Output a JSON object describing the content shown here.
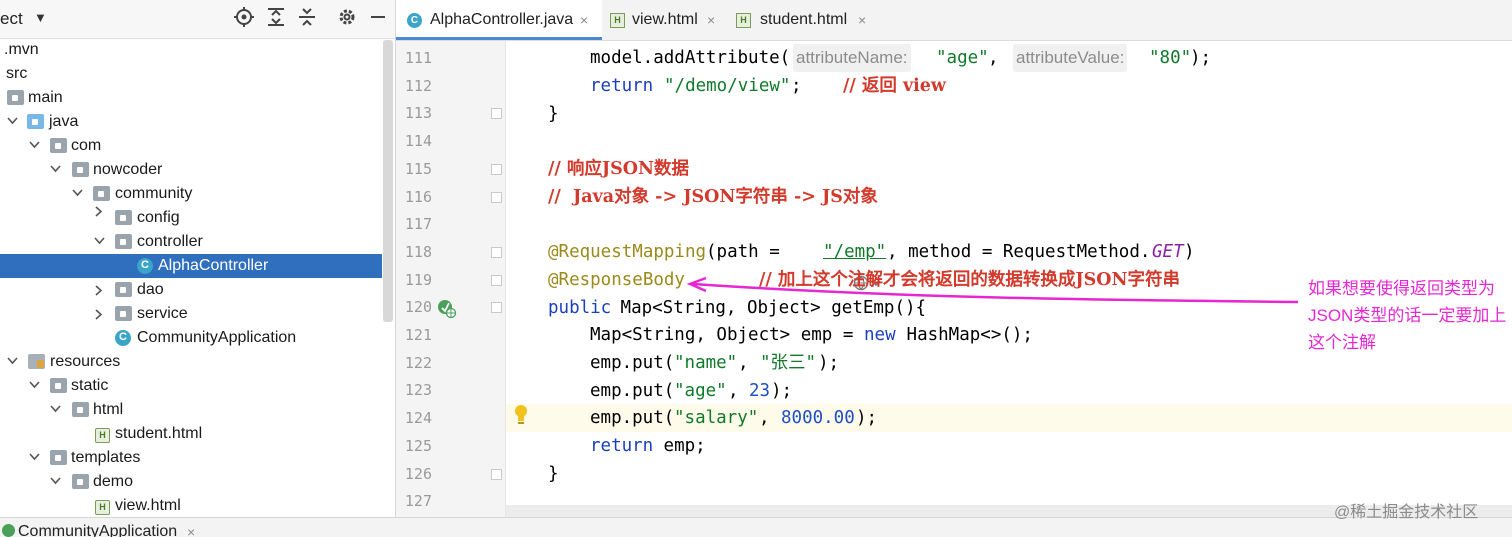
{
  "project_panel": {
    "title": "ect",
    "header_icons": [
      "target-icon",
      "expand-all-icon",
      "collapse-all-icon",
      "gear-icon",
      "minimize-icon"
    ],
    "tree": [
      {
        "label": ".mvn",
        "icon": "folder-icon",
        "arrow": "none"
      },
      {
        "label": "src",
        "icon": "none",
        "arrow": "none"
      },
      {
        "label": "main",
        "icon": "folder-icon",
        "arrow": "none"
      },
      {
        "label": "java",
        "icon": "source-folder-icon",
        "arrow": "expanded"
      },
      {
        "label": "com",
        "icon": "package-icon",
        "arrow": "expanded"
      },
      {
        "label": "nowcoder",
        "icon": "package-icon",
        "arrow": "expanded"
      },
      {
        "label": "community",
        "icon": "package-icon",
        "arrow": "expanded"
      },
      {
        "label": "config",
        "icon": "package-icon",
        "arrow": "collapsed"
      },
      {
        "label": "controller",
        "icon": "package-icon",
        "arrow": "expanded"
      },
      {
        "label": "AlphaController",
        "icon": "java-class-icon",
        "arrow": "none",
        "selected": true
      },
      {
        "label": "dao",
        "icon": "package-icon",
        "arrow": "collapsed"
      },
      {
        "label": "service",
        "icon": "package-icon",
        "arrow": "collapsed"
      },
      {
        "label": "CommunityApplication",
        "icon": "spring-class-icon",
        "arrow": "none"
      },
      {
        "label": "resources",
        "icon": "resources-folder-icon",
        "arrow": "expanded"
      },
      {
        "label": "static",
        "icon": "folder-icon",
        "arrow": "expanded"
      },
      {
        "label": "html",
        "icon": "folder-icon",
        "arrow": "expanded"
      },
      {
        "label": "student.html",
        "icon": "html-file-icon",
        "arrow": "none"
      },
      {
        "label": "templates",
        "icon": "folder-icon",
        "arrow": "expanded"
      },
      {
        "label": "demo",
        "icon": "folder-icon",
        "arrow": "expanded"
      },
      {
        "label": "view.html",
        "icon": "html-file-icon",
        "arrow": "none"
      }
    ]
  },
  "editor": {
    "tabs": [
      {
        "label": "AlphaController.java",
        "icon": "java-class-icon",
        "active": true,
        "close": "×"
      },
      {
        "label": "view.html",
        "icon": "html-file-icon",
        "active": false,
        "close": "×"
      },
      {
        "label": "student.html",
        "icon": "html-file-icon",
        "active": false,
        "close": "×"
      }
    ],
    "line_numbers": [
      "111",
      "112",
      "113",
      "114",
      "115",
      "116",
      "117",
      "118",
      "119",
      "120",
      "121",
      "122",
      "123",
      "124",
      "125",
      "126",
      "127"
    ],
    "code": {
      "l111": {
        "a": "model.addAttribute(",
        "hint1": "attributeName:",
        "s1": "\"age\"",
        "comma": ", ",
        "hint2": "attributeValue:",
        "s2": "\"80\"",
        "end": ");"
      },
      "l112": {
        "kw": "return",
        "s": "\"/demo/view\"",
        "semi": ";",
        "cmt": "// 返回 view"
      },
      "l113": {
        "t": "}"
      },
      "l115": {
        "cmt": "// 响应JSON数据"
      },
      "l116": {
        "cmt": "//  Java对象 -> JSON字符串 -> JS对象"
      },
      "l118": {
        "ann": "@RequestMapping",
        "p1": "(path = ",
        "url": "\"/emp\"",
        "p2": ", method = RequestMethod.",
        "get": "GET",
        "p3": ")"
      },
      "l119": {
        "ann": "@ResponseBody",
        "cmt": "// 加上这个注解才会将返回的数据转换成JSON字符串"
      },
      "l120": {
        "kw": "public",
        "rest": " Map<String, Object> getEmp(){"
      },
      "l121": {
        "a": "Map<String, Object> emp = ",
        "kw": "new",
        "b": " HashMap<>();"
      },
      "l122": {
        "a": "emp.put(",
        "s1": "\"name\"",
        "c": ", ",
        "s2": "\"张三\"",
        "e": ");"
      },
      "l123": {
        "a": "emp.put(",
        "s1": "\"age\"",
        "c": ", ",
        "n": "23",
        "e": ");"
      },
      "l124": {
        "a": "emp.put(",
        "s1": "\"salary\"",
        "c": ", ",
        "n": "8000.00",
        "e": ");"
      },
      "l125": {
        "kw": "return",
        "rest": " emp;"
      },
      "l126": {
        "t": "}"
      }
    }
  },
  "annotation_note": "如果想要使得返回类型为JSON类型的话一定要加上这个注解",
  "watermark": "@稀土掘金技术社区",
  "bottom_bar": {
    "run_tab": "CommunityApplication",
    "close": "×"
  },
  "colors": {
    "annotation": "#e627d4",
    "selection": "#2f6fbe",
    "comment": "#d33a2c",
    "keyword": "#1a3fbf",
    "string": "#107a2a"
  }
}
